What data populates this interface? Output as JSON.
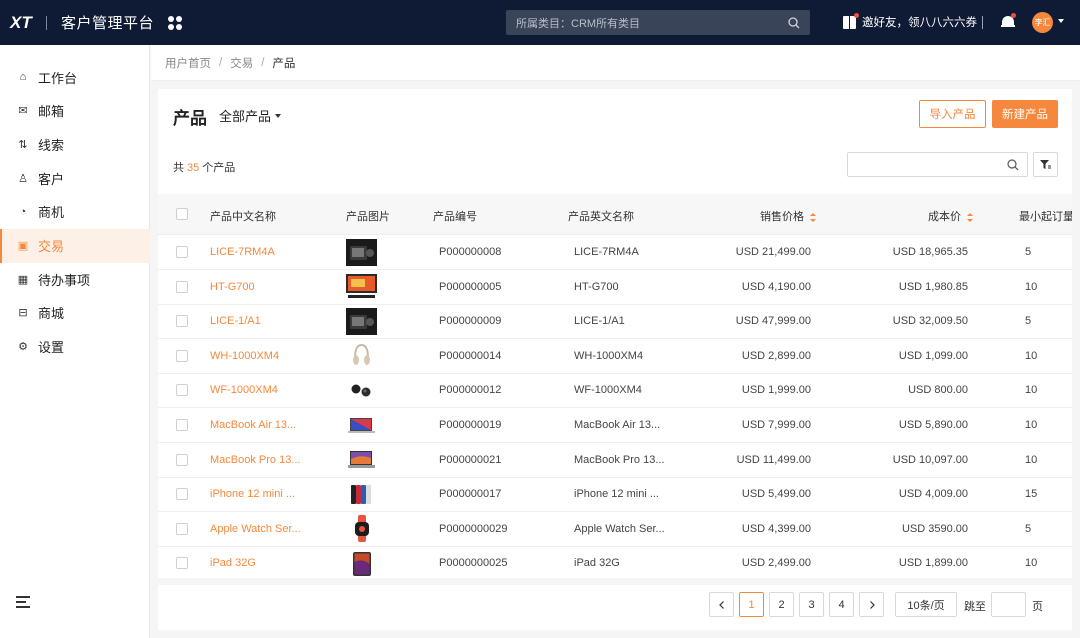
{
  "app": {
    "logo": "XT",
    "title": "客户管理平台"
  },
  "topbar": {
    "search_placeholder": "所属类目：CRM所有类目",
    "invite_text": "邀好友，领八八六六券",
    "avatar_text": "李汇"
  },
  "sidebar": {
    "items": [
      {
        "label": "工作台",
        "icon": "home-icon",
        "glyph": "⌂"
      },
      {
        "label": "邮箱",
        "icon": "mail-icon",
        "glyph": "✉"
      },
      {
        "label": "线索",
        "icon": "clue-icon",
        "glyph": "⇅"
      },
      {
        "label": "客户",
        "icon": "user-icon",
        "glyph": "♙"
      },
      {
        "label": "商机",
        "icon": "opportunity-icon",
        "glyph": "◔"
      },
      {
        "label": "交易",
        "icon": "wallet-icon",
        "glyph": "▣",
        "active": true
      },
      {
        "label": "待办事项",
        "icon": "calendar-icon",
        "glyph": "▦"
      },
      {
        "label": "商城",
        "icon": "shop-icon",
        "glyph": "⊟"
      },
      {
        "label": "设置",
        "icon": "settings-icon",
        "glyph": "⚙"
      }
    ]
  },
  "breadcrumb": {
    "items": [
      "用户首页",
      "交易",
      "产品"
    ]
  },
  "card": {
    "title": "产品",
    "filter_label": "全部产品",
    "import_label": "导入产品",
    "new_label": "新建产品",
    "count_prefix": "共",
    "count_value": "35",
    "count_suffix": "个产品"
  },
  "table": {
    "headers": {
      "cn_name": "产品中文名称",
      "image": "产品图片",
      "code": "产品编号",
      "en_name": "产品英文名称",
      "price": "销售价格",
      "cost": "成本价",
      "min_qty": "最小起订量"
    },
    "rows": [
      {
        "cn_name": "LICE-7RM4A",
        "thumb": "camera-black",
        "code": "P000000008",
        "en_name": "LICE-7RM4A",
        "price": "USD 21,499.00",
        "cost": "USD 18,965.35",
        "min_qty": "5"
      },
      {
        "cn_name": "HT-G700",
        "thumb": "tv-soundbar",
        "code": "P000000005",
        "en_name": "HT-G700",
        "price": "USD 4,190.00",
        "cost": "USD 1,980.85",
        "min_qty": "10"
      },
      {
        "cn_name": "LICE-1/A1",
        "thumb": "camera-black",
        "code": "P000000009",
        "en_name": "LICE-1/A1",
        "price": "USD 47,999.00",
        "cost": "USD 32,009.50",
        "min_qty": "5"
      },
      {
        "cn_name": "WH-1000XM4",
        "thumb": "headphones",
        "code": "P000000014",
        "en_name": "WH-1000XM4",
        "price": "USD 2,899.00",
        "cost": "USD 1,099.00",
        "min_qty": "10"
      },
      {
        "cn_name": "WF-1000XM4",
        "thumb": "earbuds",
        "code": "P000000012",
        "en_name": "WF-1000XM4",
        "price": "USD 1,999.00",
        "cost": "USD 800.00",
        "min_qty": "10"
      },
      {
        "cn_name": "MacBook Air 13...",
        "thumb": "laptop",
        "code": "P000000019",
        "en_name": "MacBook Air 13...",
        "price": "USD 7,999.00",
        "cost": "USD 5,890.00",
        "min_qty": "10"
      },
      {
        "cn_name": "MacBook Pro 13...",
        "thumb": "laptop-pro",
        "code": "P000000021",
        "en_name": "MacBook Pro 13...",
        "price": "USD 11,499.00",
        "cost": "USD 10,097.00",
        "min_qty": "10"
      },
      {
        "cn_name": "iPhone 12 mini ...",
        "thumb": "phones",
        "code": "P000000017",
        "en_name": "iPhone 12 mini ...",
        "price": "USD 5,499.00",
        "cost": "USD 4,009.00",
        "min_qty": "15"
      },
      {
        "cn_name": "Apple Watch Ser...",
        "thumb": "watch",
        "code": "P0000000029",
        "en_name": "Apple Watch Ser...",
        "price": "USD 4,399.00",
        "cost": "USD 3590.00",
        "min_qty": "5"
      },
      {
        "cn_name": "iPad 32G",
        "thumb": "tablet",
        "code": "P0000000025",
        "en_name": "iPad 32G",
        "price": "USD 2,499.00",
        "cost": "USD 1,899.00",
        "min_qty": "10"
      }
    ]
  },
  "pagination": {
    "pages": [
      "1",
      "2",
      "3",
      "4"
    ],
    "current": "1",
    "page_size": "10条/页",
    "jump_label": "跳至",
    "page_label": "页"
  },
  "colors": {
    "accent": "#f5883c",
    "topbar": "#0f1b35"
  }
}
